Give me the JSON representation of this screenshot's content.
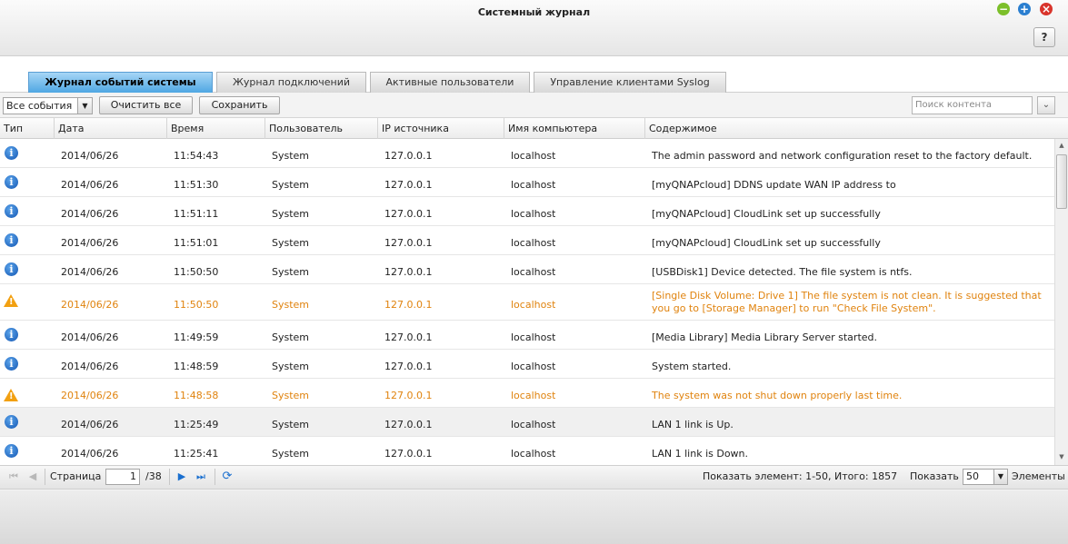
{
  "window": {
    "title": "Системный журнал",
    "help_label": "?"
  },
  "tabs": [
    {
      "label": "Журнал событий системы",
      "active": true
    },
    {
      "label": "Журнал подключений",
      "active": false
    },
    {
      "label": "Активные пользователи",
      "active": false
    },
    {
      "label": "Управление клиентами Syslog",
      "active": false
    }
  ],
  "toolbar": {
    "filter_value": "Все события",
    "clear_label": "Очистить все",
    "save_label": "Сохранить",
    "search_placeholder": "Поиск контента"
  },
  "columns": [
    "Тип",
    "Дата",
    "Время",
    "Пользователь",
    "IP источника",
    "Имя компьютера",
    "Содержимое"
  ],
  "rows": [
    {
      "type": "info",
      "date": "2014/06/26",
      "time": "11:54:43",
      "user": "System",
      "ip": "127.0.0.1",
      "host": "localhost",
      "content": "The admin password and network configuration reset to the factory default."
    },
    {
      "type": "info",
      "date": "2014/06/26",
      "time": "11:51:30",
      "user": "System",
      "ip": "127.0.0.1",
      "host": "localhost",
      "content": "[myQNAPcloud] DDNS update WAN IP address to"
    },
    {
      "type": "info",
      "date": "2014/06/26",
      "time": "11:51:11",
      "user": "System",
      "ip": "127.0.0.1",
      "host": "localhost",
      "content": "[myQNAPcloud] CloudLink set up successfully"
    },
    {
      "type": "info",
      "date": "2014/06/26",
      "time": "11:51:01",
      "user": "System",
      "ip": "127.0.0.1",
      "host": "localhost",
      "content": "[myQNAPcloud] CloudLink set up successfully"
    },
    {
      "type": "info",
      "date": "2014/06/26",
      "time": "11:50:50",
      "user": "System",
      "ip": "127.0.0.1",
      "host": "localhost",
      "content": "[USBDisk1] Device detected. The file system is ntfs."
    },
    {
      "type": "warning",
      "date": "2014/06/26",
      "time": "11:50:50",
      "user": "System",
      "ip": "127.0.0.1",
      "host": "localhost",
      "content": "[Single Disk Volume: Drive 1] The file system is not clean. It is suggested that you go to [Storage Manager] to run \"Check File System\"."
    },
    {
      "type": "info",
      "date": "2014/06/26",
      "time": "11:49:59",
      "user": "System",
      "ip": "127.0.0.1",
      "host": "localhost",
      "content": "[Media Library] Media Library Server started."
    },
    {
      "type": "info",
      "date": "2014/06/26",
      "time": "11:48:59",
      "user": "System",
      "ip": "127.0.0.1",
      "host": "localhost",
      "content": "System started."
    },
    {
      "type": "warning",
      "date": "2014/06/26",
      "time": "11:48:58",
      "user": "System",
      "ip": "127.0.0.1",
      "host": "localhost",
      "content": "The system was not shut down properly last time."
    },
    {
      "type": "info",
      "date": "2014/06/26",
      "time": "11:25:49",
      "user": "System",
      "ip": "127.0.0.1",
      "host": "localhost",
      "content": "LAN 1 link is Up."
    },
    {
      "type": "info",
      "date": "2014/06/26",
      "time": "11:25:41",
      "user": "System",
      "ip": "127.0.0.1",
      "host": "localhost",
      "content": "LAN 1 link is Down."
    }
  ],
  "pager": {
    "page_label": "Страница",
    "page_value": "1",
    "total_pages": "/38",
    "summary": "Показать элемент: 1-50, Итого: 1857",
    "show_label": "Показать",
    "page_size": "50",
    "items_label": "Элементы"
  },
  "colors": {
    "warning": "#e0830e",
    "info_icon": "#1457b3",
    "active_tab": "#4fa7e3"
  }
}
